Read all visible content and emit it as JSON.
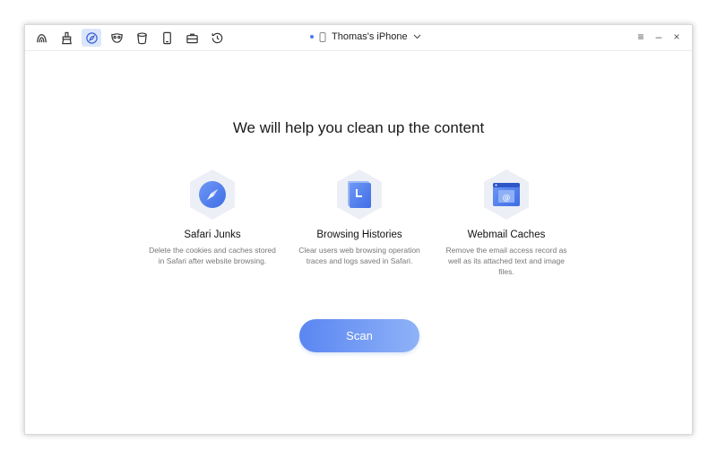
{
  "toolbar": {
    "tools": [
      {
        "icon": "privacy-shield-icon"
      },
      {
        "icon": "brush-clean-icon"
      },
      {
        "icon": "safari-compass-icon",
        "active": true
      },
      {
        "icon": "mask-icon"
      },
      {
        "icon": "trash-bin-icon"
      },
      {
        "icon": "phone-icon"
      },
      {
        "icon": "briefcase-icon"
      },
      {
        "icon": "history-clock-icon"
      }
    ],
    "device_name": "Thomas's iPhone",
    "window_controls": {
      "menu": "≡",
      "minimize": "–",
      "close": "×"
    }
  },
  "main": {
    "headline": "We will help you clean up the content",
    "features": [
      {
        "title": "Safari Junks",
        "description": "Delete the cookies and caches stored in Safari after website browsing.",
        "icon": "compass-icon"
      },
      {
        "title": "Browsing Histories",
        "description": "Clear users web browsing operation traces and logs saved in Safari.",
        "icon": "history-document-icon"
      },
      {
        "title": "Webmail Caches",
        "description": "Remove the email access record as well as its attached text and image files.",
        "icon": "webmail-icon"
      }
    ],
    "scan_label": "Scan"
  },
  "colors": {
    "accent": "#4d79f0",
    "active_tool_bg": "#dbe6fb",
    "hex_bg": "#eceff5"
  }
}
